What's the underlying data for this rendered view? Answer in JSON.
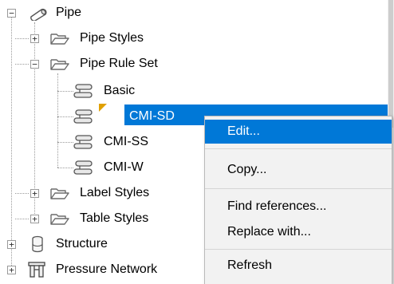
{
  "tree": {
    "pipe": "Pipe",
    "pipe_styles": "Pipe Styles",
    "pipe_rule_set": "Pipe Rule Set",
    "basic": "Basic",
    "cmi_sd": "CMI-SD",
    "cmi_ss": "CMI-SS",
    "cmi_w": "CMI-W",
    "label_styles": "Label Styles",
    "table_styles": "Table Styles",
    "structure": "Structure",
    "pressure_network": "Pressure Network",
    "collapse_glyph": "−",
    "expand_glyph": "+"
  },
  "context_menu": {
    "edit": "Edit...",
    "copy": "Copy...",
    "find_references": "Find references...",
    "replace_with": "Replace with...",
    "refresh": "Refresh"
  },
  "colors": {
    "selection": "#0078d7",
    "menu_background": "#f2f2f2",
    "tree_lines": "#9a9a9a",
    "folder_outline": "#6b6b6b",
    "warning_flag": "#e0a000"
  },
  "icons": [
    "pipe-icon",
    "folder-icon",
    "rule-icon",
    "structure-icon",
    "pressure-network-icon",
    "warning-flag-icon"
  ]
}
